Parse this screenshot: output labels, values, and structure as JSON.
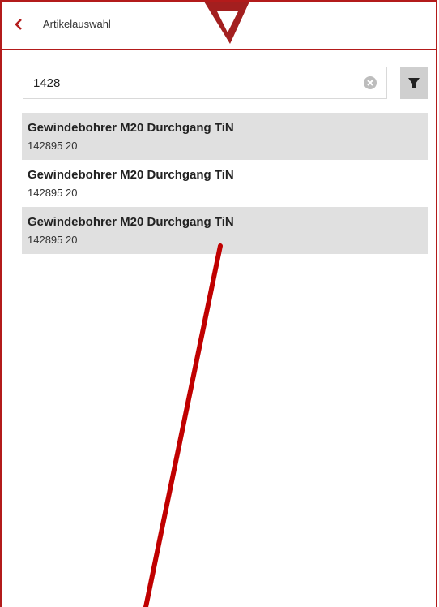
{
  "header": {
    "title": "Artikelauswahl",
    "accent_color": "#b31b1b"
  },
  "search": {
    "value": "1428"
  },
  "results": [
    {
      "title": "Gewindebohrer M20 Durchgang TiN",
      "subtitle": "142895 20"
    },
    {
      "title": "Gewindebohrer M20 Durchgang TiN",
      "subtitle": "142895 20"
    },
    {
      "title": "Gewindebohrer M20 Durchgang TiN",
      "subtitle": "142895 20"
    }
  ]
}
